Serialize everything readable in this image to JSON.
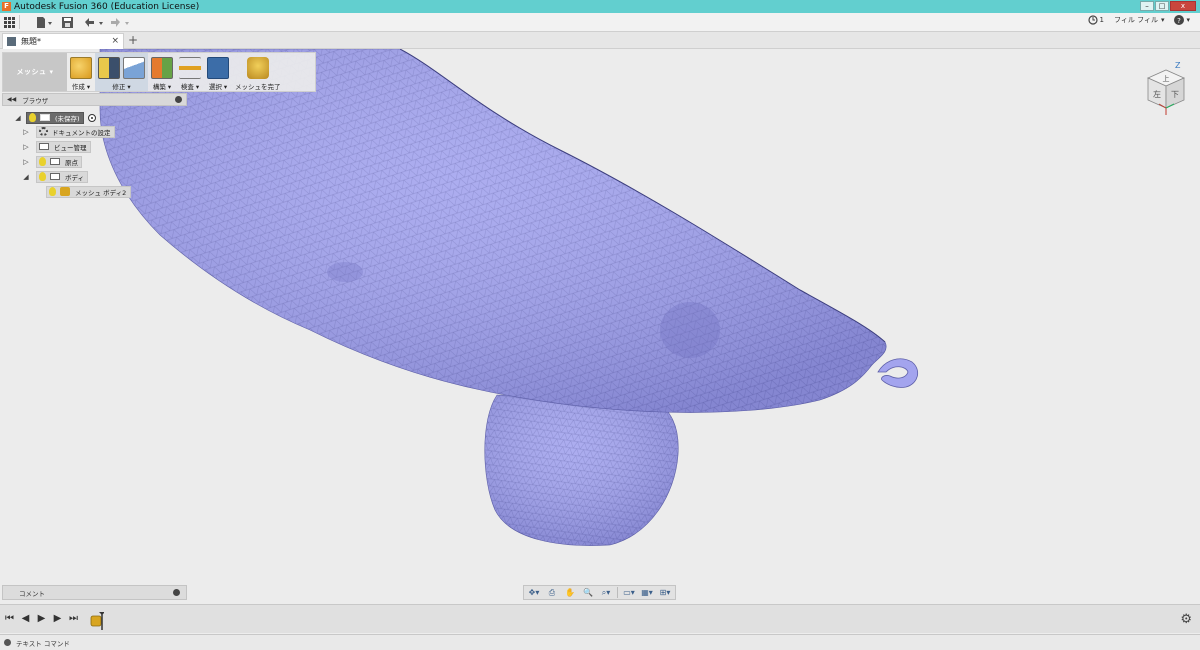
{
  "window": {
    "title": "Autodesk Fusion 360 (Education License)",
    "app_icon_letter": "F",
    "minimize": "–",
    "maximize": "□",
    "close": "x"
  },
  "qat": {
    "apps_icon": "grid-icon",
    "file_icon": "file-icon",
    "save_icon": "save-icon",
    "undo_icon": "undo-icon",
    "redo_icon": "redo-icon",
    "job_count": "1",
    "user_label": "フィル フィル",
    "help_icon": "help-icon"
  },
  "doc_tab": {
    "name": "無題*",
    "close": "×",
    "new_tab": "+"
  },
  "ribbon": {
    "workspace": "メッシュ",
    "groups": [
      {
        "label": "作成"
      },
      {
        "label": "修正"
      },
      {
        "label": "構築"
      },
      {
        "label": "検査"
      },
      {
        "label": "選択"
      },
      {
        "label": "メッシュを完了"
      }
    ]
  },
  "browser": {
    "title": "ブラウザ",
    "items": [
      {
        "label": "(未保存)"
      },
      {
        "label": "ドキュメントの設定"
      },
      {
        "label": "ビュー管理"
      },
      {
        "label": "原点"
      },
      {
        "label": "ボディ"
      },
      {
        "label": "メッシュ ボディ2"
      }
    ]
  },
  "viewcube": {
    "axis": "Z",
    "top_face": "上",
    "front_face": "左",
    "right_face": "下"
  },
  "comments": {
    "label": "コメント"
  },
  "command_bar": {
    "label": "テキスト コマンド"
  },
  "colors": {
    "mesh_fill": "#a3a4ee",
    "titlebar": "#62cfcf",
    "viewport": "#ececec"
  }
}
